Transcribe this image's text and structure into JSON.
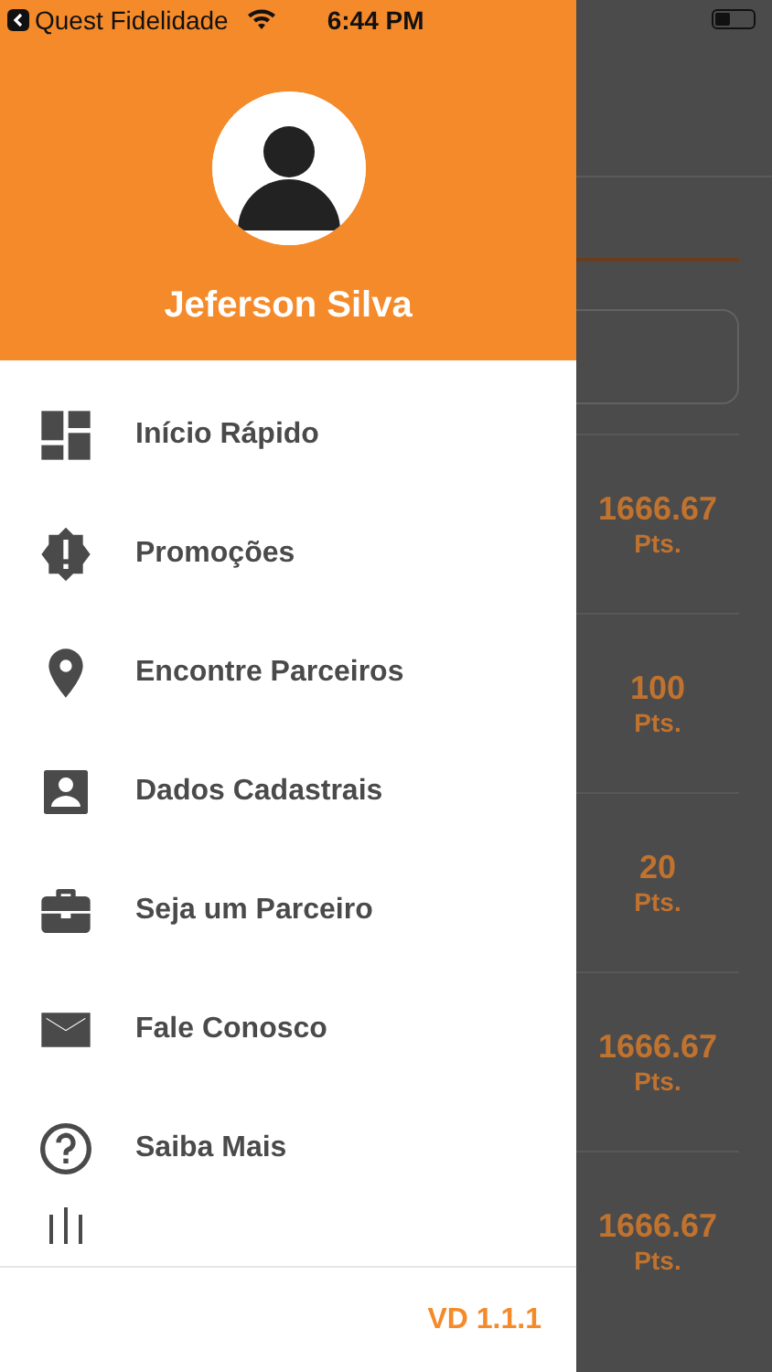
{
  "status_bar": {
    "back_app": "Quest Fidelidade",
    "time": "6:44 PM"
  },
  "drawer": {
    "user_name": "Jeferson Silva",
    "menu": [
      {
        "label": "Início Rápido"
      },
      {
        "label": "Promoções"
      },
      {
        "label": "Encontre Parceiros"
      },
      {
        "label": "Dados Cadastrais"
      },
      {
        "label": "Seja um Parceiro"
      },
      {
        "label": "Fale Conosco"
      },
      {
        "label": "Saiba Mais"
      }
    ],
    "version": "VD 1.1.1"
  },
  "background": {
    "rows": [
      {
        "points": "1666.67",
        "unit": "Pts."
      },
      {
        "points": "100",
        "unit": "Pts."
      },
      {
        "points": "20",
        "unit": "Pts."
      },
      {
        "points": "1666.67",
        "unit": "Pts."
      },
      {
        "points": "1666.67",
        "unit": "Pts."
      }
    ]
  }
}
